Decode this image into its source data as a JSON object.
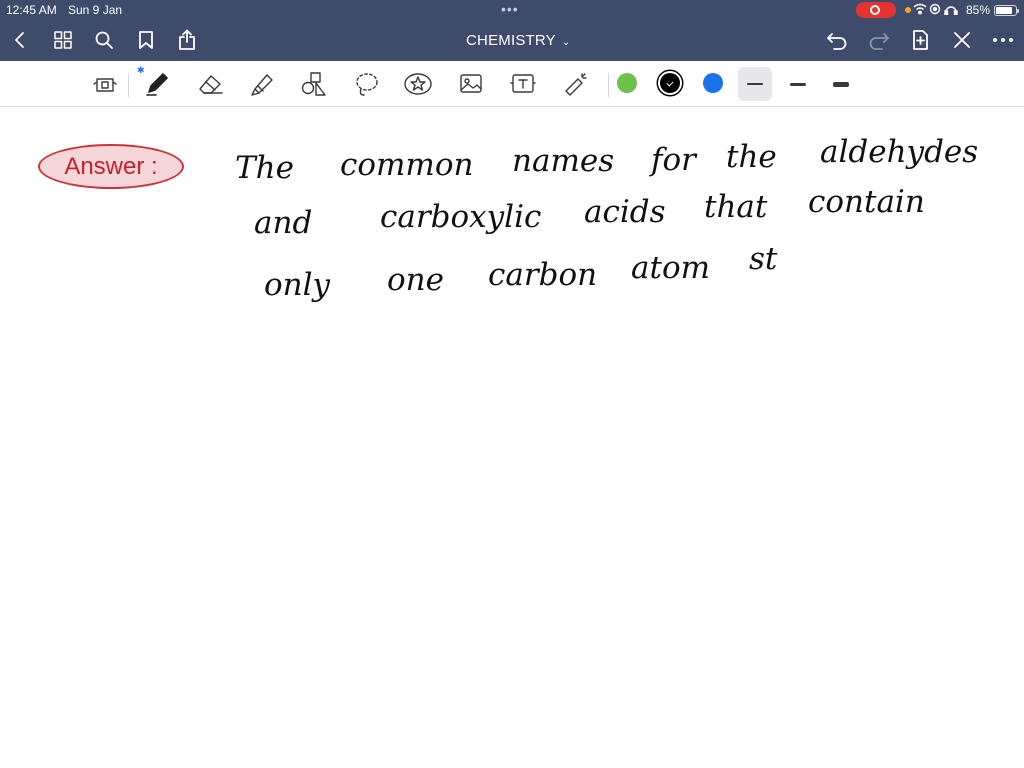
{
  "status_bar": {
    "time": "12:45 AM",
    "date": "Sun 9 Jan",
    "multitask_dots": "•••",
    "battery_percent": "85%",
    "battery_level": 0.85
  },
  "nav": {
    "title": "CHEMISTRY",
    "chevron": "⌄",
    "icons": [
      "back-chevron-icon",
      "grid-icon",
      "search-icon",
      "bookmark-icon",
      "share-icon",
      "undo-icon",
      "redo-icon",
      "add-page-icon",
      "close-icon",
      "more-icon"
    ]
  },
  "toolbar": {
    "tools": [
      "read-mode-icon",
      "pen-icon",
      "eraser-icon",
      "highlighter-icon",
      "shapes-icon",
      "lasso-icon",
      "sticker-icon",
      "image-icon",
      "text-icon",
      "laser-pointer-icon"
    ],
    "colors": [
      "#6cc24a",
      "#000000",
      "#1a73e8"
    ],
    "selected_color": "#000000",
    "selected_stroke": 1
  },
  "note": {
    "label": "Answer :",
    "lines": [
      [
        "The",
        "common",
        "names",
        "for",
        "the",
        "aldehydes"
      ],
      [
        "and",
        "carboxylic",
        "acids",
        "that",
        "contain"
      ],
      [
        "only",
        "one",
        "carbon",
        "atom",
        "st"
      ]
    ]
  },
  "colors": {
    "chrome": "#3f4b6b",
    "answer_fill": "#f6d7d9",
    "answer_border": "#c8353a",
    "answer_text": "#c8202a"
  }
}
